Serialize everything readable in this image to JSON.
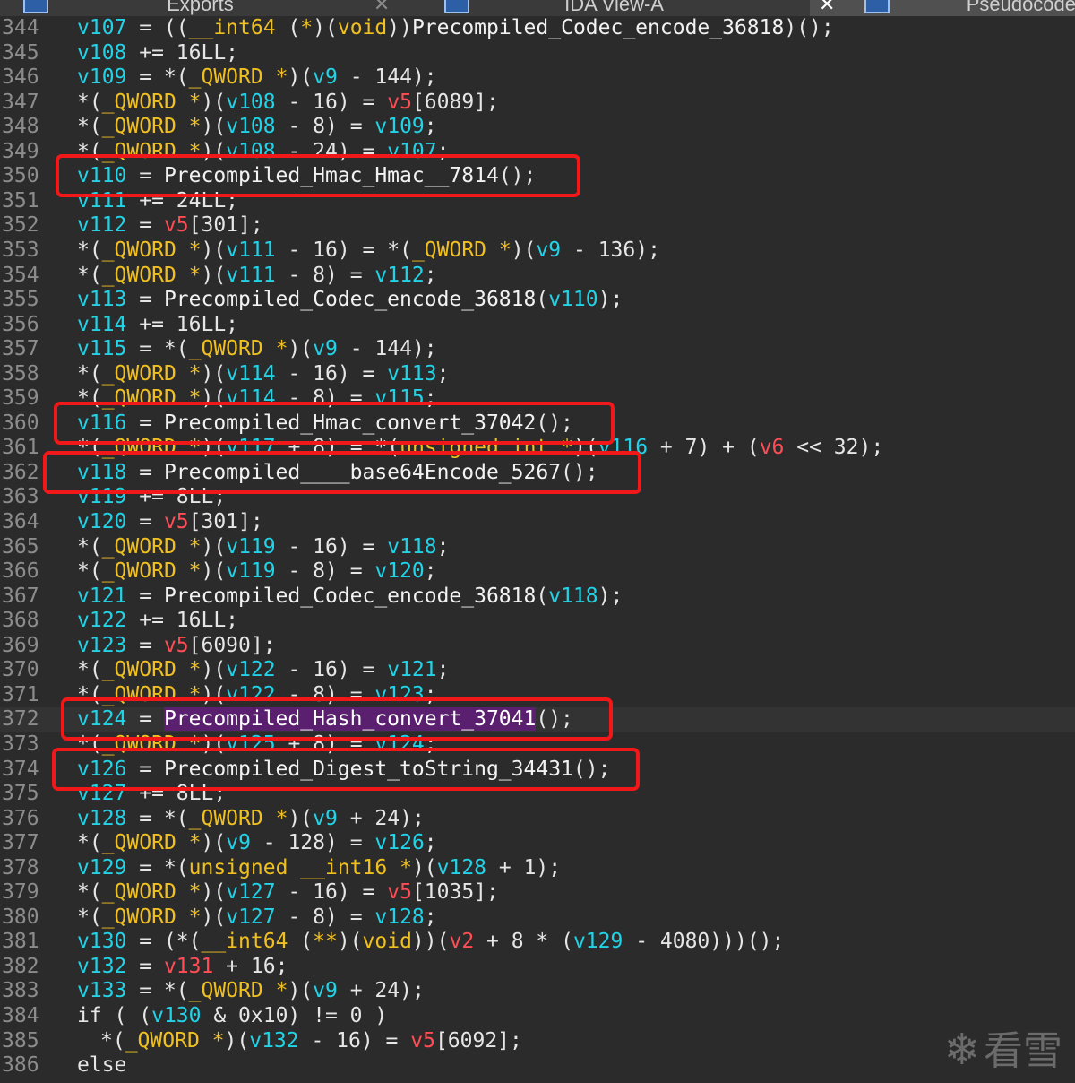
{
  "tabs": [
    {
      "label": "Exports",
      "icon": "exports-icon"
    },
    {
      "label": "IDA View-A",
      "icon": "ida-view-icon"
    },
    {
      "label": "Pseudocode",
      "icon": "pseudocode-icon"
    }
  ],
  "code_lines": [
    {
      "n": "344",
      "tokens": [
        [
          "v",
          "v107"
        ],
        [
          "p",
          " = (("
        ],
        [
          "t",
          "__int64"
        ],
        [
          "p",
          " ("
        ],
        [
          "t",
          "*"
        ],
        [
          "p",
          ")("
        ],
        [
          "t",
          "void"
        ],
        [
          "p",
          "))"
        ],
        [
          "f",
          "Precompiled_Codec_encode_36818"
        ],
        [
          "p",
          ")();"
        ]
      ]
    },
    {
      "n": "345",
      "tokens": [
        [
          "v",
          "v108"
        ],
        [
          "p",
          " += 16LL;"
        ]
      ]
    },
    {
      "n": "346",
      "tokens": [
        [
          "v",
          "v109"
        ],
        [
          "p",
          " = *("
        ],
        [
          "t",
          "_QWORD"
        ],
        [
          "p",
          " "
        ],
        [
          "t",
          "*"
        ],
        [
          "p",
          ")("
        ],
        [
          "v",
          "v9"
        ],
        [
          "p",
          " - 144);"
        ]
      ]
    },
    {
      "n": "347",
      "tokens": [
        [
          "p",
          "*("
        ],
        [
          "t",
          "_QWORD"
        ],
        [
          "p",
          " "
        ],
        [
          "t",
          "*"
        ],
        [
          "p",
          ")("
        ],
        [
          "v",
          "v108"
        ],
        [
          "p",
          " - 16) = "
        ],
        [
          "r",
          "v5"
        ],
        [
          "p",
          "[6089];"
        ]
      ]
    },
    {
      "n": "348",
      "tokens": [
        [
          "p",
          "*("
        ],
        [
          "t",
          "_QWORD"
        ],
        [
          "p",
          " "
        ],
        [
          "t",
          "*"
        ],
        [
          "p",
          ")("
        ],
        [
          "v",
          "v108"
        ],
        [
          "p",
          " - 8) = "
        ],
        [
          "v",
          "v109"
        ],
        [
          "p",
          ";"
        ]
      ]
    },
    {
      "n": "349",
      "tokens": [
        [
          "p",
          "*("
        ],
        [
          "t",
          "_QWORD"
        ],
        [
          "p",
          " "
        ],
        [
          "t",
          "*"
        ],
        [
          "p",
          ")("
        ],
        [
          "v",
          "v108"
        ],
        [
          "p",
          " - 24) = "
        ],
        [
          "v",
          "v107"
        ],
        [
          "p",
          ";"
        ]
      ]
    },
    {
      "n": "350",
      "tokens": [
        [
          "v",
          "v110"
        ],
        [
          "p",
          " = "
        ],
        [
          "f",
          "Precompiled_Hmac_Hmac__7814"
        ],
        [
          "p",
          "();"
        ]
      ]
    },
    {
      "n": "351",
      "tokens": [
        [
          "v",
          "v111"
        ],
        [
          "p",
          " += 24LL;"
        ]
      ]
    },
    {
      "n": "352",
      "tokens": [
        [
          "v",
          "v112"
        ],
        [
          "p",
          " = "
        ],
        [
          "r",
          "v5"
        ],
        [
          "p",
          "[301];"
        ]
      ]
    },
    {
      "n": "353",
      "tokens": [
        [
          "p",
          "*("
        ],
        [
          "t",
          "_QWORD"
        ],
        [
          "p",
          " "
        ],
        [
          "t",
          "*"
        ],
        [
          "p",
          ")("
        ],
        [
          "v",
          "v111"
        ],
        [
          "p",
          " - 16) = *("
        ],
        [
          "t",
          "_QWORD"
        ],
        [
          "p",
          " "
        ],
        [
          "t",
          "*"
        ],
        [
          "p",
          ")("
        ],
        [
          "v",
          "v9"
        ],
        [
          "p",
          " - 136);"
        ]
      ]
    },
    {
      "n": "354",
      "tokens": [
        [
          "p",
          "*("
        ],
        [
          "t",
          "_QWORD"
        ],
        [
          "p",
          " "
        ],
        [
          "t",
          "*"
        ],
        [
          "p",
          ")("
        ],
        [
          "v",
          "v111"
        ],
        [
          "p",
          " - 8) = "
        ],
        [
          "v",
          "v112"
        ],
        [
          "p",
          ";"
        ]
      ]
    },
    {
      "n": "355",
      "tokens": [
        [
          "v",
          "v113"
        ],
        [
          "p",
          " = "
        ],
        [
          "f",
          "Precompiled_Codec_encode_36818"
        ],
        [
          "p",
          "("
        ],
        [
          "v",
          "v110"
        ],
        [
          "p",
          ");"
        ]
      ]
    },
    {
      "n": "356",
      "tokens": [
        [
          "v",
          "v114"
        ],
        [
          "p",
          " += 16LL;"
        ]
      ]
    },
    {
      "n": "357",
      "tokens": [
        [
          "v",
          "v115"
        ],
        [
          "p",
          " = *("
        ],
        [
          "t",
          "_QWORD"
        ],
        [
          "p",
          " "
        ],
        [
          "t",
          "*"
        ],
        [
          "p",
          ")("
        ],
        [
          "v",
          "v9"
        ],
        [
          "p",
          " - 144);"
        ]
      ]
    },
    {
      "n": "358",
      "tokens": [
        [
          "p",
          "*("
        ],
        [
          "t",
          "_QWORD"
        ],
        [
          "p",
          " "
        ],
        [
          "t",
          "*"
        ],
        [
          "p",
          ")("
        ],
        [
          "v",
          "v114"
        ],
        [
          "p",
          " - 16) = "
        ],
        [
          "v",
          "v113"
        ],
        [
          "p",
          ";"
        ]
      ]
    },
    {
      "n": "359",
      "tokens": [
        [
          "p",
          "*("
        ],
        [
          "t",
          "_QWORD"
        ],
        [
          "p",
          " "
        ],
        [
          "t",
          "*"
        ],
        [
          "p",
          ")("
        ],
        [
          "v",
          "v114"
        ],
        [
          "p",
          " - 8) = "
        ],
        [
          "v",
          "v115"
        ],
        [
          "p",
          ";"
        ]
      ]
    },
    {
      "n": "360",
      "tokens": [
        [
          "v",
          "v116"
        ],
        [
          "p",
          " = "
        ],
        [
          "f",
          "Precompiled_Hmac_convert_37042"
        ],
        [
          "p",
          "();"
        ]
      ]
    },
    {
      "n": "361",
      "tokens": [
        [
          "p",
          "*("
        ],
        [
          "t",
          "_QWORD"
        ],
        [
          "p",
          " "
        ],
        [
          "t",
          "*"
        ],
        [
          "p",
          ")("
        ],
        [
          "v",
          "v117"
        ],
        [
          "p",
          " + 8) = *("
        ],
        [
          "t",
          "unsigned int"
        ],
        [
          "p",
          " "
        ],
        [
          "t",
          "*"
        ],
        [
          "p",
          ")("
        ],
        [
          "v",
          "v116"
        ],
        [
          "p",
          " + 7) + ("
        ],
        [
          "r",
          "v6"
        ],
        [
          "p",
          " << 32);"
        ]
      ]
    },
    {
      "n": "362",
      "tokens": [
        [
          "v",
          "v118"
        ],
        [
          "p",
          " = "
        ],
        [
          "f",
          "Precompiled____base64Encode_5267"
        ],
        [
          "p",
          "();"
        ]
      ]
    },
    {
      "n": "363",
      "tokens": [
        [
          "v",
          "v119"
        ],
        [
          "p",
          " += 8LL;"
        ]
      ]
    },
    {
      "n": "364",
      "tokens": [
        [
          "v",
          "v120"
        ],
        [
          "p",
          " = "
        ],
        [
          "r",
          "v5"
        ],
        [
          "p",
          "[301];"
        ]
      ]
    },
    {
      "n": "365",
      "tokens": [
        [
          "p",
          "*("
        ],
        [
          "t",
          "_QWORD"
        ],
        [
          "p",
          " "
        ],
        [
          "t",
          "*"
        ],
        [
          "p",
          ")("
        ],
        [
          "v",
          "v119"
        ],
        [
          "p",
          " - 16) = "
        ],
        [
          "v",
          "v118"
        ],
        [
          "p",
          ";"
        ]
      ]
    },
    {
      "n": "366",
      "tokens": [
        [
          "p",
          "*("
        ],
        [
          "t",
          "_QWORD"
        ],
        [
          "p",
          " "
        ],
        [
          "t",
          "*"
        ],
        [
          "p",
          ")("
        ],
        [
          "v",
          "v119"
        ],
        [
          "p",
          " - 8) = "
        ],
        [
          "v",
          "v120"
        ],
        [
          "p",
          ";"
        ]
      ]
    },
    {
      "n": "367",
      "tokens": [
        [
          "v",
          "v121"
        ],
        [
          "p",
          " = "
        ],
        [
          "f",
          "Precompiled_Codec_encode_36818"
        ],
        [
          "p",
          "("
        ],
        [
          "v",
          "v118"
        ],
        [
          "p",
          ");"
        ]
      ]
    },
    {
      "n": "368",
      "tokens": [
        [
          "v",
          "v122"
        ],
        [
          "p",
          " += 16LL;"
        ]
      ]
    },
    {
      "n": "369",
      "tokens": [
        [
          "v",
          "v123"
        ],
        [
          "p",
          " = "
        ],
        [
          "r",
          "v5"
        ],
        [
          "p",
          "[6090];"
        ]
      ]
    },
    {
      "n": "370",
      "tokens": [
        [
          "p",
          "*("
        ],
        [
          "t",
          "_QWORD"
        ],
        [
          "p",
          " "
        ],
        [
          "t",
          "*"
        ],
        [
          "p",
          ")("
        ],
        [
          "v",
          "v122"
        ],
        [
          "p",
          " - 16) = "
        ],
        [
          "v",
          "v121"
        ],
        [
          "p",
          ";"
        ]
      ]
    },
    {
      "n": "371",
      "tokens": [
        [
          "p",
          "*("
        ],
        [
          "t",
          "_QWORD"
        ],
        [
          "p",
          " "
        ],
        [
          "t",
          "*"
        ],
        [
          "p",
          ")("
        ],
        [
          "v",
          "v122"
        ],
        [
          "p",
          " - 8) = "
        ],
        [
          "v",
          "v123"
        ],
        [
          "p",
          ";"
        ]
      ]
    },
    {
      "n": "372",
      "tokens": [
        [
          "v",
          "v124"
        ],
        [
          "p",
          " = "
        ],
        [
          "hl",
          "Precompiled_Hash_convert_37041"
        ],
        [
          "p",
          "();"
        ]
      ]
    },
    {
      "n": "373",
      "tokens": [
        [
          "p",
          "*("
        ],
        [
          "t",
          "_QWORD"
        ],
        [
          "p",
          " "
        ],
        [
          "t",
          "*"
        ],
        [
          "p",
          ")("
        ],
        [
          "v",
          "v125"
        ],
        [
          "p",
          " + 8) = "
        ],
        [
          "v",
          "v124"
        ],
        [
          "p",
          ";"
        ]
      ]
    },
    {
      "n": "374",
      "tokens": [
        [
          "v",
          "v126"
        ],
        [
          "p",
          " = "
        ],
        [
          "f",
          "Precompiled_Digest_toString_34431"
        ],
        [
          "p",
          "();"
        ]
      ]
    },
    {
      "n": "375",
      "tokens": [
        [
          "v",
          "v127"
        ],
        [
          "p",
          " += 8LL;"
        ]
      ]
    },
    {
      "n": "376",
      "tokens": [
        [
          "v",
          "v128"
        ],
        [
          "p",
          " = *("
        ],
        [
          "t",
          "_QWORD"
        ],
        [
          "p",
          " "
        ],
        [
          "t",
          "*"
        ],
        [
          "p",
          ")("
        ],
        [
          "v",
          "v9"
        ],
        [
          "p",
          " + 24);"
        ]
      ]
    },
    {
      "n": "377",
      "tokens": [
        [
          "p",
          "*("
        ],
        [
          "t",
          "_QWORD"
        ],
        [
          "p",
          " "
        ],
        [
          "t",
          "*"
        ],
        [
          "p",
          ")("
        ],
        [
          "v",
          "v9"
        ],
        [
          "p",
          " - 128) = "
        ],
        [
          "v",
          "v126"
        ],
        [
          "p",
          ";"
        ]
      ]
    },
    {
      "n": "378",
      "tokens": [
        [
          "v",
          "v129"
        ],
        [
          "p",
          " = *("
        ],
        [
          "t",
          "unsigned"
        ],
        [
          "p",
          " "
        ],
        [
          "t",
          "__int16"
        ],
        [
          "p",
          " "
        ],
        [
          "t",
          "*"
        ],
        [
          "p",
          ")("
        ],
        [
          "v",
          "v128"
        ],
        [
          "p",
          " + 1);"
        ]
      ]
    },
    {
      "n": "379",
      "tokens": [
        [
          "p",
          "*("
        ],
        [
          "t",
          "_QWORD"
        ],
        [
          "p",
          " "
        ],
        [
          "t",
          "*"
        ],
        [
          "p",
          ")("
        ],
        [
          "v",
          "v127"
        ],
        [
          "p",
          " - 16) = "
        ],
        [
          "r",
          "v5"
        ],
        [
          "p",
          "[1035];"
        ]
      ]
    },
    {
      "n": "380",
      "tokens": [
        [
          "p",
          "*("
        ],
        [
          "t",
          "_QWORD"
        ],
        [
          "p",
          " "
        ],
        [
          "t",
          "*"
        ],
        [
          "p",
          ")("
        ],
        [
          "v",
          "v127"
        ],
        [
          "p",
          " - 8) = "
        ],
        [
          "v",
          "v128"
        ],
        [
          "p",
          ";"
        ]
      ]
    },
    {
      "n": "381",
      "tokens": [
        [
          "v",
          "v130"
        ],
        [
          "p",
          " = (*("
        ],
        [
          "t",
          "__int64"
        ],
        [
          "p",
          " ("
        ],
        [
          "t",
          "**"
        ],
        [
          "p",
          ")("
        ],
        [
          "t",
          "void"
        ],
        [
          "p",
          "))("
        ],
        [
          "r",
          "v2"
        ],
        [
          "p",
          " + 8 * ("
        ],
        [
          "v",
          "v129"
        ],
        [
          "p",
          " - 4080)))();"
        ]
      ]
    },
    {
      "n": "382",
      "tokens": [
        [
          "v",
          "v132"
        ],
        [
          "p",
          " = "
        ],
        [
          "r",
          "v131"
        ],
        [
          "p",
          " + 16;"
        ]
      ]
    },
    {
      "n": "383",
      "tokens": [
        [
          "v",
          "v133"
        ],
        [
          "p",
          " = *("
        ],
        [
          "t",
          "_QWORD"
        ],
        [
          "p",
          " "
        ],
        [
          "t",
          "*"
        ],
        [
          "p",
          ")("
        ],
        [
          "v",
          "v9"
        ],
        [
          "p",
          " + 24);"
        ]
      ]
    },
    {
      "n": "384",
      "tokens": [
        [
          "kw",
          "if"
        ],
        [
          "p",
          " ( ("
        ],
        [
          "v",
          "v130"
        ],
        [
          "p",
          " & 0x10) != 0 )"
        ]
      ]
    },
    {
      "n": "385",
      "indent": true,
      "tokens": [
        [
          "p",
          "*("
        ],
        [
          "t",
          "_QWORD"
        ],
        [
          "p",
          " "
        ],
        [
          "t",
          "*"
        ],
        [
          "p",
          ")("
        ],
        [
          "v",
          "v132"
        ],
        [
          "p",
          " - 16) = "
        ],
        [
          "r",
          "v5"
        ],
        [
          "p",
          "[6092];"
        ]
      ]
    },
    {
      "n": "386",
      "tokens": [
        [
          "kw",
          "else"
        ]
      ]
    }
  ],
  "highlight_boxes": [
    {
      "line": "350",
      "label": "v110 = Precompiled_Hmac_Hmac__7814();"
    },
    {
      "line": "360",
      "label": "v116 = Precompiled_Hmac_convert_37042();"
    },
    {
      "line": "362",
      "label": "v118 = Precompiled____base64Encode_5267();"
    },
    {
      "line": "372",
      "label": "v124 = Precompiled_Hash_convert_37041();"
    },
    {
      "line": "374",
      "label": "v126 = Precompiled_Digest_toString_34431();"
    }
  ],
  "watermark": {
    "text": "看雪",
    "icon": "snowflake-icon"
  },
  "colors": {
    "variable": "#22d3e8",
    "type": "#f0c020",
    "global": "#ff4d55",
    "box": "#f01818",
    "selection": "#5a1f6e"
  }
}
